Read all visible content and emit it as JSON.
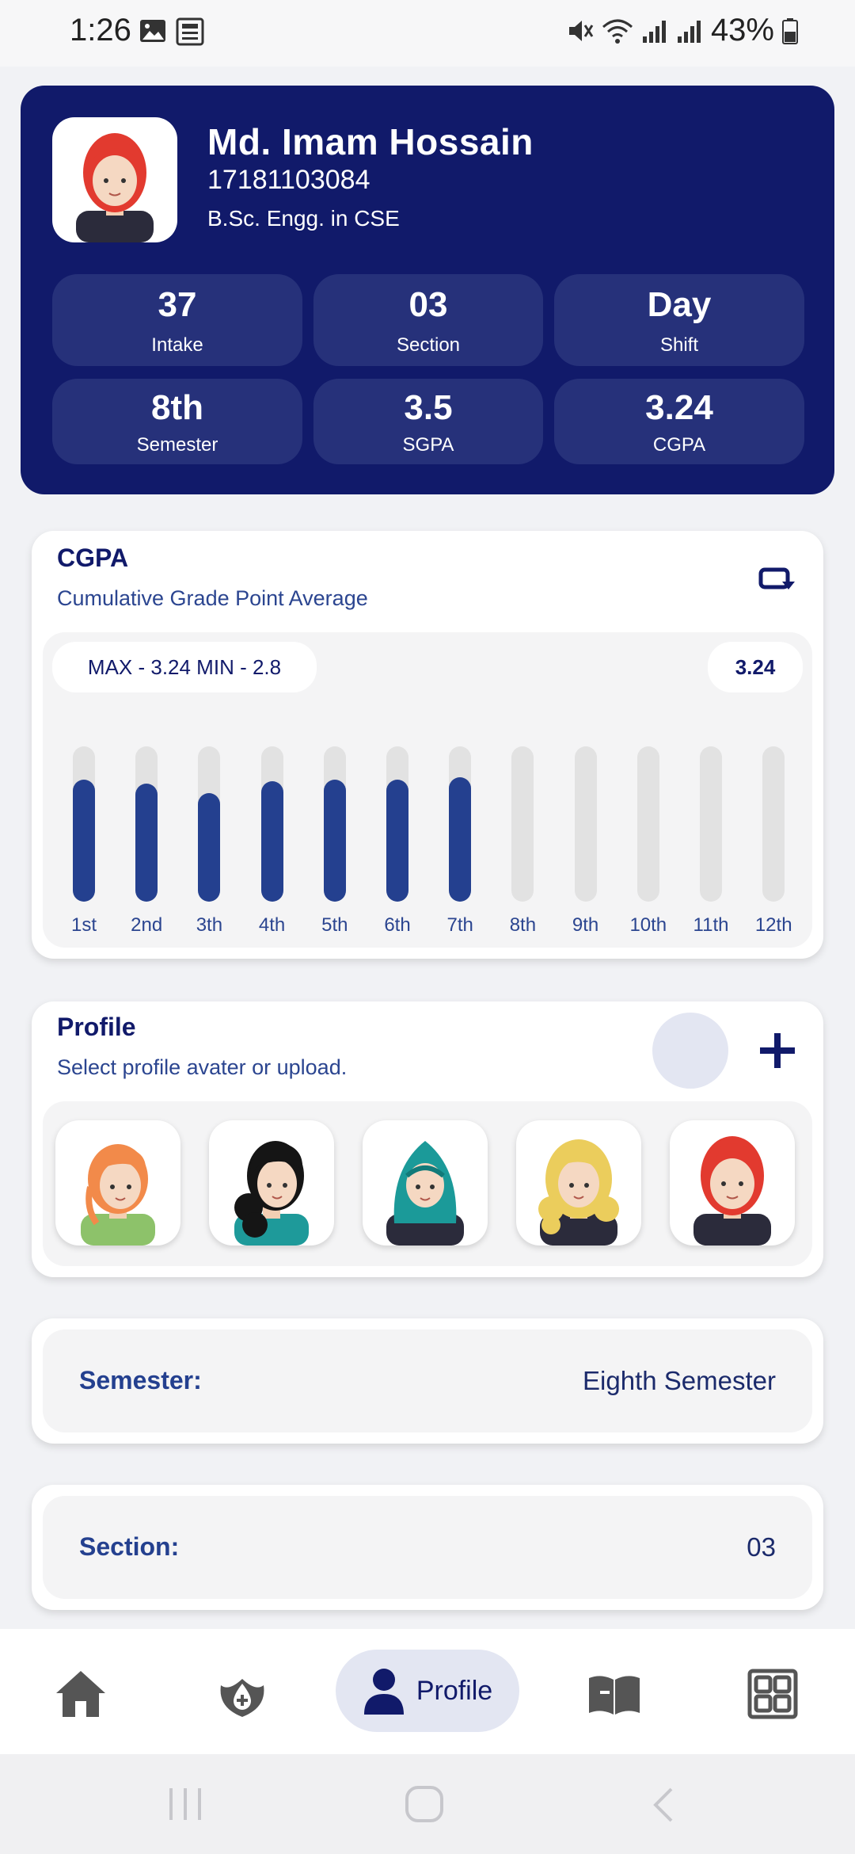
{
  "status_bar": {
    "time": "1:26",
    "battery": "43%"
  },
  "header": {
    "name": "Md. Imam Hossain",
    "student_id": "17181103084",
    "department": "B.Sc. Engg. in CSE",
    "stats": [
      {
        "value": "37",
        "label": "Intake"
      },
      {
        "value": "03",
        "label": "Section"
      },
      {
        "value": "Day",
        "label": "Shift"
      },
      {
        "value": "8th",
        "label": "Semester"
      },
      {
        "value": "3.5",
        "label": "SGPA"
      },
      {
        "value": "3.24",
        "label": "CGPA"
      }
    ]
  },
  "cgpa_card": {
    "title": "CGPA",
    "subtitle": "Cumulative Grade Point Average",
    "range_label": "MAX - 3.24 MIN - 2.8",
    "current": "3.24"
  },
  "chart_data": {
    "type": "bar",
    "categories": [
      "1st",
      "2nd",
      "3th",
      "4th",
      "5th",
      "6th",
      "7th",
      "8th",
      "9th",
      "10th",
      "11th",
      "12th"
    ],
    "values": [
      3.15,
      3.05,
      2.8,
      3.1,
      3.15,
      3.15,
      3.2,
      0,
      0,
      0,
      0,
      0
    ],
    "title": "",
    "xlabel": "",
    "ylabel": "",
    "ylim": [
      0,
      4
    ]
  },
  "profile_card": {
    "title": "Profile",
    "subtitle": "Select profile avater or upload.",
    "avatars": [
      "avatar-orange-hair",
      "avatar-black-hair",
      "avatar-hijab",
      "avatar-blonde-hair",
      "avatar-red-hair"
    ]
  },
  "semester_row": {
    "label": "Semester:",
    "value": "Eighth Semester"
  },
  "section_row": {
    "label": "Section:",
    "value": "03"
  },
  "bottom_nav": {
    "active_label": "Profile",
    "items": [
      "home-icon",
      "blood-drop-icon",
      "profile-icon",
      "book-icon",
      "grid-icon"
    ]
  },
  "colors": {
    "primary": "#111a6a",
    "bar": "#24408f",
    "track": "#e2e2e2"
  }
}
